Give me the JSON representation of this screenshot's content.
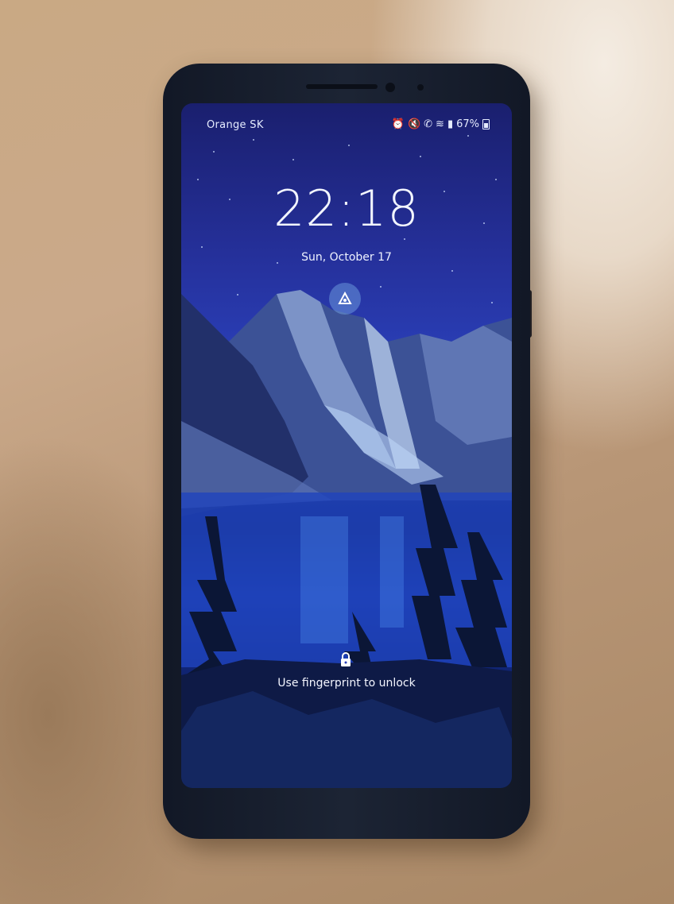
{
  "status_bar": {
    "carrier": "Orange SK",
    "battery_percent": "67%",
    "icons": [
      "alarm-icon",
      "mute-icon",
      "call-icon",
      "wifi-icon",
      "signal-icon",
      "battery-icon"
    ]
  },
  "lock_screen": {
    "time": "22:18",
    "date": "Sun, October 17",
    "shortcut_icon": "assistant-icon",
    "unlock_hint": "Use fingerprint to unlock",
    "lock_icon": "lock-icon"
  },
  "colors": {
    "wallpaper_sky": "#25309a",
    "wallpaper_lake": "#1a3aa8",
    "text": "#f2f5ff",
    "phone_body": "#1c2434"
  }
}
